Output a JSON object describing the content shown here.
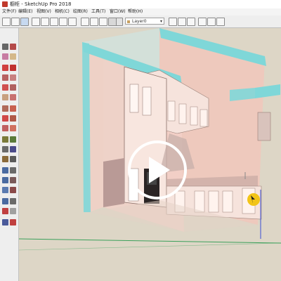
{
  "window": {
    "title": "橱柜 - SketchUp Pro 2018"
  },
  "menu": [
    "文件(F)",
    "编辑(E)",
    "视图(V)",
    "相机(C)",
    "绘图(R)",
    "工具(T)",
    "窗口(W)",
    "帮助(H)"
  ],
  "toolbar": {
    "layer_value": "Layer0"
  },
  "colors": {
    "glass": "#7fd7d8",
    "wall": "#f2cdc2",
    "cabinet": "#f6e3dc",
    "marble": "#b99a96",
    "cursor": "#f2c417",
    "axis_green": "#3aa05a",
    "axis_blue": "#3a4fd6"
  }
}
